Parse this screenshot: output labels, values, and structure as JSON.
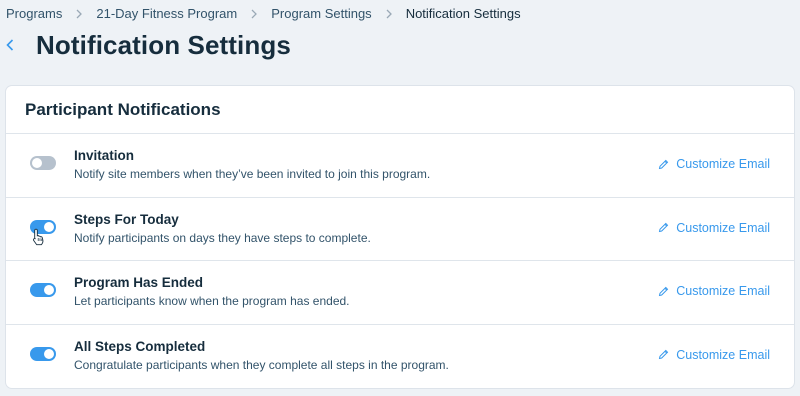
{
  "breadcrumb": [
    {
      "label": "Programs"
    },
    {
      "label": "21-Day Fitness Program"
    },
    {
      "label": "Program Settings"
    },
    {
      "label": "Notification Settings"
    }
  ],
  "page": {
    "title": "Notification Settings"
  },
  "section": {
    "title": "Participant Notifications"
  },
  "notifications": [
    {
      "title": "Invitation",
      "description": "Notify site members when they’ve been invited to join this program.",
      "enabled": false,
      "action": "Customize Email"
    },
    {
      "title": "Steps For Today",
      "description": "Notify participants on days they have steps to complete.",
      "enabled": true,
      "action": "Customize Email"
    },
    {
      "title": "Program Has Ended",
      "description": "Let participants know when the program has ended.",
      "enabled": true,
      "action": "Customize Email"
    },
    {
      "title": "All Steps Completed",
      "description": "Congratulate participants when they complete all steps in the program.",
      "enabled": true,
      "action": "Customize Email"
    }
  ],
  "icons": {
    "back": "chevron-left-icon",
    "separator": "chevron-right-icon",
    "edit": "pencil-icon",
    "cursor": "hand-pointer-icon"
  },
  "colors": {
    "accent": "#3899ec",
    "toggle_off": "#b6c1cd",
    "text_primary": "#162d3d",
    "text_secondary": "#32536a",
    "page_bg": "#eef2f6"
  }
}
